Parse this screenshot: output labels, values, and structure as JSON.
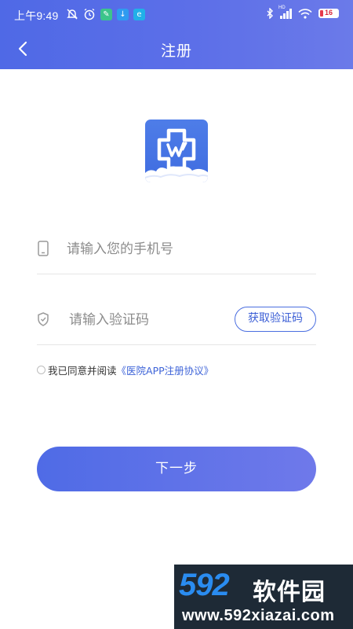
{
  "status_bar": {
    "time": "上午9:49",
    "battery_level": "16",
    "battery_fraction": 0.16,
    "network_label": "HD",
    "icons": [
      "mute-icon",
      "alarm-icon",
      "app-icon",
      "download-icon",
      "browser-icon",
      "bluetooth-icon",
      "signal-icon",
      "wifi-icon",
      "battery-icon"
    ]
  },
  "nav": {
    "title": "注册",
    "back_icon": "chevron-left-icon"
  },
  "form": {
    "phone": {
      "placeholder": "请输入您的手机号",
      "value": "",
      "icon": "phone-icon"
    },
    "code": {
      "placeholder": "请输入验证码",
      "value": "",
      "icon": "shield-icon",
      "button_label": "获取验证码"
    },
    "agreement": {
      "checked": false,
      "text": "我已同意并阅读",
      "link_text": "《医院APP注册协议》"
    },
    "next_label": "下一步"
  },
  "colors": {
    "primary": "#4f6be6",
    "primary_light": "#6f79ea",
    "link": "#3d63d8",
    "battery_low": "#e5394c"
  },
  "watermark": {
    "main": "592",
    "cn": "软件园",
    "url": "www.592xiazai.com"
  }
}
